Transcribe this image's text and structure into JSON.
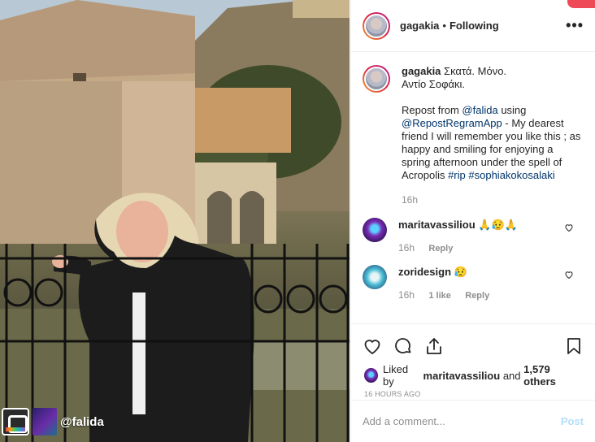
{
  "photo": {
    "handle": "@falida"
  },
  "header": {
    "username": "gagakia",
    "separator": "•",
    "following": "Following",
    "more": "•••"
  },
  "caption": {
    "username": "gagakia",
    "line1": "Σκατά. Μόνο.",
    "line2": "Αντίο Σοφάκι.",
    "repost_prefix": "Repost from ",
    "repost_user": "@falida",
    "using": " using",
    "app": "@RepostRegramApp",
    "text": " - My dearest friend I will remember you like this ; as happy and smiling for enjoying a spring afternoon under the spell of Acropolis ",
    "tag1": "#rip",
    "tag2": "#sophiakokosalaki",
    "time": "16h"
  },
  "comments": [
    {
      "username": "maritavassiliou",
      "text": "🙏😥🙏",
      "time": "16h",
      "likes": "",
      "reply": "Reply"
    },
    {
      "username": "zoridesign",
      "text": "😥",
      "time": "16h",
      "likes": "1 like",
      "reply": "Reply"
    }
  ],
  "likes": {
    "prefix": "Liked by ",
    "user": "maritavassiliou",
    "middle": " and ",
    "count": "1,579 others"
  },
  "timestamp": "16 HOURS AGO",
  "add_comment": {
    "placeholder": "Add a comment...",
    "post_label": "Post"
  },
  "colors": {
    "link": "#003569",
    "post_disabled": "#b2dffc",
    "muted": "#8e8e8e",
    "notify": "#ed4956"
  }
}
